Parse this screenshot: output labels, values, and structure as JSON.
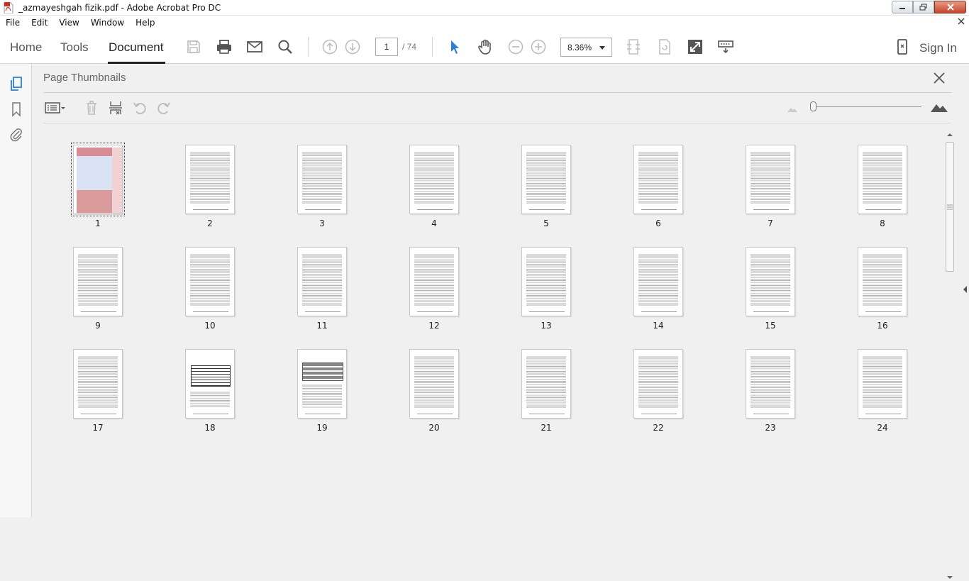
{
  "window": {
    "title": "_azmayeshgah fizik.pdf - Adobe Acrobat Pro DC"
  },
  "menu": {
    "items": [
      "File",
      "Edit",
      "View",
      "Window",
      "Help"
    ]
  },
  "toolbar": {
    "tabs": [
      "Home",
      "Tools",
      "Document"
    ],
    "active_tab": "Document",
    "current_page": "1",
    "page_total": "/ 74",
    "zoom": "8.36%",
    "sign_in": "Sign In"
  },
  "panel": {
    "title": "Page Thumbnails",
    "thumbnail_size_level": 0.0
  },
  "thumbnails": {
    "selected_page": "1",
    "pages": [
      "1",
      "2",
      "3",
      "4",
      "5",
      "6",
      "7",
      "8",
      "9",
      "10",
      "11",
      "12",
      "13",
      "14",
      "15",
      "16",
      "17",
      "18",
      "19",
      "20",
      "21",
      "22",
      "23",
      "24"
    ]
  },
  "colors": {
    "accent": "#2d7fd3",
    "cover_pink": "#f0d2d4",
    "cover_red": "#d88b93",
    "cover_blue": "#d9e2f3"
  }
}
